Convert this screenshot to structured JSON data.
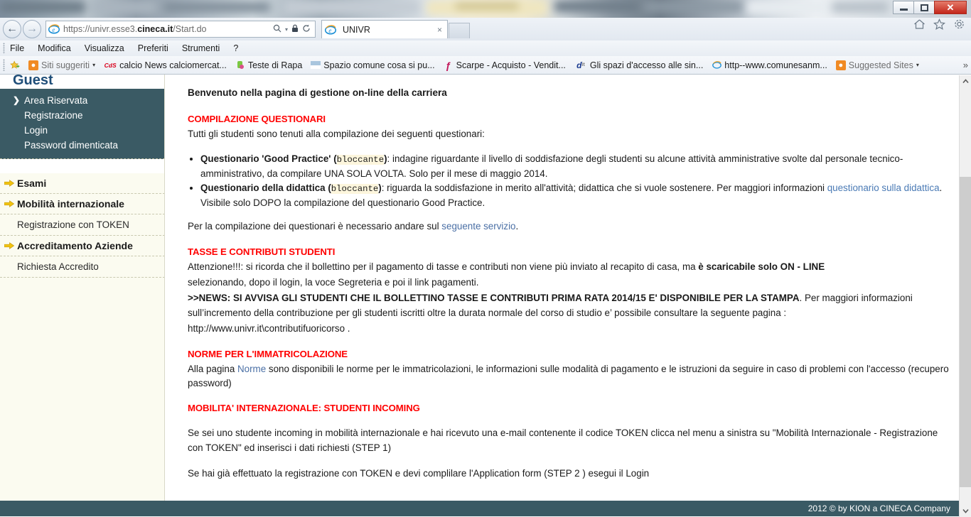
{
  "browser": {
    "back_label": "Back",
    "forward_label": "Forward",
    "url_prefix": "https://univr.esse3.",
    "url_domain": "cineca.it",
    "url_suffix": "/Start.do",
    "search_icon": "search-icon",
    "lock_icon": "lock-icon",
    "refresh_icon": "refresh-icon",
    "dropdown_caret": "▾",
    "tab_label": "UNIVR",
    "tab_close": "×",
    "window_controls": {
      "minimize": "minimize-icon",
      "restore": "restore-icon",
      "close": "✕"
    },
    "tools": {
      "home": "home-icon",
      "favorites": "star-icon",
      "settings": "gear-icon"
    },
    "menu": [
      "File",
      "Modifica",
      "Visualizza",
      "Preferiti",
      "Strumenti",
      "?"
    ],
    "favorites_overflow": "»",
    "favorites": [
      {
        "label": "Siti suggeriti",
        "icon": "suggested-sites-icon",
        "icon_text": "b",
        "icon_bg": "#f08a24",
        "icon_color": "#ffffff",
        "grey": true,
        "chevron": "▾"
      },
      {
        "label": "calcio News calciomercat...",
        "icon": "cds-icon",
        "icon_text": "CdS",
        "icon_bg": "transparent",
        "icon_color": "#d9001b",
        "grey": false,
        "chevron": ""
      },
      {
        "label": "Teste di Rapa",
        "icon": "teste-di-rapa-icon",
        "icon_text": "",
        "icon_bg": "#6ab42e",
        "icon_color": "#ffffff",
        "grey": false,
        "chevron": ""
      },
      {
        "label": "Spazio comune cosa si pu...",
        "icon": "spazio-comune-icon",
        "icon_text": "",
        "icon_bg": "#b9cfe2",
        "icon_color": "#ffffff",
        "grey": false,
        "chevron": ""
      },
      {
        "label": "Scarpe - Acquisto - Vendit...",
        "icon": "scarpe-icon",
        "icon_text": "ƒ",
        "icon_bg": "transparent",
        "icon_color": "#c2185b",
        "grey": false,
        "chevron": ""
      },
      {
        "label": "Gli spazi d'accesso alle sin...",
        "icon": "dit-icon",
        "icon_text": "d",
        "icon_bg": "transparent",
        "icon_color": "#1a3a8f",
        "grey": false,
        "chevron": ""
      },
      {
        "label": "http--www.comunesanm...",
        "icon": "ie-page-icon",
        "icon_text": "e",
        "icon_bg": "transparent",
        "icon_color": "#1a8fd6",
        "grey": false,
        "chevron": ""
      },
      {
        "label": "Suggested Sites",
        "icon": "suggested-sites-icon",
        "icon_text": "b",
        "icon_bg": "#f08a24",
        "icon_color": "#ffffff",
        "grey": true,
        "chevron": "▾"
      }
    ]
  },
  "sidebar": {
    "user_title": "Guest",
    "login_items": [
      {
        "label": "Area Riservata",
        "current": true,
        "chevron": "❯"
      },
      {
        "label": "Registrazione",
        "current": false,
        "chevron": ""
      },
      {
        "label": "Login",
        "current": false,
        "chevron": ""
      },
      {
        "label": "Password dimenticata",
        "current": false,
        "chevron": ""
      }
    ],
    "sections": [
      {
        "type": "section",
        "label": "Esami"
      },
      {
        "type": "section",
        "label": "Mobilità internazionale"
      },
      {
        "type": "sub",
        "label": "Registrazione con TOKEN"
      },
      {
        "type": "section",
        "label": "Accreditamento Aziende"
      },
      {
        "type": "sub",
        "label": "Richiesta Accredito"
      }
    ]
  },
  "content": {
    "welcome": "Benvenuto nella pagina di gestione on-line della carriera",
    "sections": {
      "questionari": {
        "heading": "COMPILAZIONE QUESTIONARI",
        "intro": "Tutti gli studenti sono tenuti alla compilazione dei seguenti questionari:",
        "items": [
          {
            "title": "Questionario 'Good Practice'",
            "tag": "bloccante",
            "body": ": indagine riguardante il livello di soddisfazione degli studenti su alcune attività amministrative svolte dal personale tecnico-amministrativo, da compilare UNA SOLA VOLTA. Solo per il mese di maggio 2014."
          },
          {
            "title": "Questionario della didattica",
            "tag": "bloccante",
            "body_before": ": riguarda la soddisfazione in merito all'attività; didattica che si vuole sostenere. Per maggiori informazioni ",
            "link": "questionario sulla didattica",
            "body_after": ". Visibile solo DOPO la compilazione del questionario Good Practice."
          }
        ],
        "closing_before": "Per la compilazione dei questionari è necessario andare sul ",
        "closing_link": "seguente servizio",
        "closing_after": "."
      },
      "tasse": {
        "heading": "TASSE E CONTRIBUTI STUDENTI",
        "line1_before": "Attenzione!!!: si ricorda che il bollettino per il pagamento di tasse e contributi non viene più inviato al recapito di casa, ma ",
        "line1_bold": "è scaricabile solo ON - LINE",
        "line2": "selezionando, dopo il login, la voce Segreteria e poi il link pagamenti.",
        "news_bold": ">>NEWS: SI AVVISA GLI STUDENTI CHE IL BOLLETTINO TASSE E CONTRIBUTI PRIMA RATA 2014/15 E' DISPONIBILE PER LA STAMPA",
        "news_after": ". Per maggiori informazioni sull’incremento della contribuzione per gli studenti iscritti oltre la durata normale del corso di studio e’ possibile consultare la seguente pagina :",
        "news_url": "http://www.univr.it\\contributifuoricorso ."
      },
      "norme": {
        "heading": "NORME PER L'IMMATRICOLAZIONE",
        "before": "Alla pagina ",
        "link": "Norme",
        "after": " sono disponibili le norme per le immatricolazioni, le informazioni sulle modalità di pagamento e le istruzioni da seguire in caso di problemi con l'accesso (recupero password)"
      },
      "mobilita": {
        "heading": "MOBILITA' INTERNAZIONALE: STUDENTI INCOMING",
        "p1": "Se sei uno studente incoming in mobilità internazionale e hai ricevuto una e-mail contenente il codice TOKEN clicca nel menu a sinistra su \"Mobilità Internazionale - Registrazione con TOKEN\" ed inserisci i dati richiesti (STEP 1)",
        "p2": "Se hai già effettuato la registrazione con TOKEN e devi complilare l'Application form (STEP 2 ) esegui il Login"
      }
    }
  },
  "footer": {
    "copyright": "2012 © by KION a CINECA Company"
  },
  "scrollbar": {
    "up": "⌃",
    "down": "⌄"
  },
  "colors": {
    "accent_dark": "#3a5a64",
    "heading_red": "#ff0000",
    "guest_blue": "#1f4e79",
    "link_blue": "#4a6fa5",
    "sidebar_bg": "#fbfbf0",
    "highlight_bg": "#fdf6dd"
  }
}
